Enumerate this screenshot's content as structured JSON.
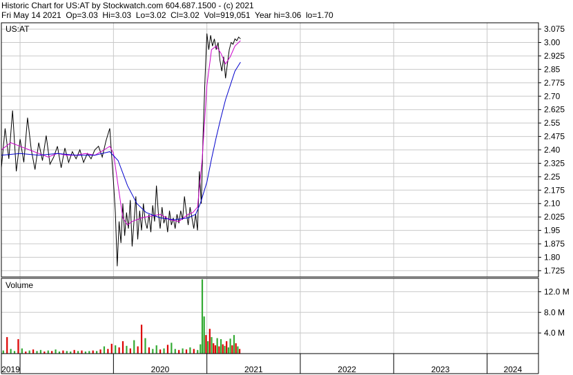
{
  "header": {
    "line1": "Historic Chart for US:AT by Stockwatch.com 604.687.1500 - (c) 2021",
    "line2": "Fri May 14 2021  Op=3.03  Hi=3.03  Lo=3.02  Cl=3.02  Vol=919,051  Year hi=3.06  lo=1.70"
  },
  "colors": {
    "price": "#000000",
    "ma_short": "#cc00cc",
    "ma_long": "#0000cc",
    "volume_up": "#33aa33",
    "volume_down": "#dd0000",
    "grid": "#c8c8c8",
    "frame": "#000000"
  },
  "chart_data": [
    {
      "type": "line",
      "title": "US:AT",
      "y_ticks": [
        "3.075",
        "3.00",
        "2.925",
        "2.85",
        "2.775",
        "2.70",
        "2.625",
        "2.55",
        "2.475",
        "2.40",
        "2.325",
        "2.25",
        "2.175",
        "2.10",
        "2.025",
        "1.95",
        "1.875",
        "1.80",
        "1.725"
      ],
      "ylim": [
        1.69,
        3.11
      ],
      "x_ticks": [
        "2019",
        "2020",
        "2021",
        "2022",
        "2023",
        "2024"
      ],
      "xlim": [
        2018.8,
        2024.55
      ],
      "grid": true,
      "series": [
        {
          "role": "price",
          "x": [
            2018.8,
            2018.84,
            2018.88,
            2018.92,
            2018.96,
            2019.0,
            2019.04,
            2019.08,
            2019.12,
            2019.16,
            2019.2,
            2019.24,
            2019.28,
            2019.32,
            2019.36,
            2019.4,
            2019.44,
            2019.48,
            2019.52,
            2019.56,
            2019.6,
            2019.64,
            2019.68,
            2019.72,
            2019.76,
            2019.8,
            2019.84,
            2019.88,
            2019.92,
            2019.96,
            2020.0,
            2020.02,
            2020.04,
            2020.06,
            2020.08,
            2020.1,
            2020.12,
            2020.14,
            2020.16,
            2020.18,
            2020.2,
            2020.22,
            2020.24,
            2020.26,
            2020.28,
            2020.3,
            2020.32,
            2020.34,
            2020.36,
            2020.38,
            2020.4,
            2020.42,
            2020.44,
            2020.46,
            2020.48,
            2020.5,
            2020.52,
            2020.54,
            2020.56,
            2020.58,
            2020.6,
            2020.62,
            2020.64,
            2020.66,
            2020.68,
            2020.7,
            2020.72,
            2020.74,
            2020.76,
            2020.78,
            2020.8,
            2020.82,
            2020.84,
            2020.86,
            2020.88,
            2020.9,
            2020.92,
            2020.94,
            2020.96,
            2020.98,
            2021.0,
            2021.02,
            2021.04,
            2021.06,
            2021.08,
            2021.1,
            2021.12,
            2021.14,
            2021.16,
            2021.18,
            2021.2,
            2021.22,
            2021.24,
            2021.26,
            2021.28,
            2021.3,
            2021.32,
            2021.34,
            2021.36
          ],
          "values": [
            2.3,
            2.52,
            2.35,
            2.62,
            2.28,
            2.46,
            2.33,
            2.58,
            2.4,
            2.29,
            2.44,
            2.34,
            2.48,
            2.32,
            2.36,
            2.42,
            2.3,
            2.41,
            2.33,
            2.39,
            2.35,
            2.4,
            2.33,
            2.38,
            2.35,
            2.4,
            2.42,
            2.36,
            2.45,
            2.52,
            2.22,
            2.05,
            1.75,
            2.0,
            1.88,
            2.1,
            1.92,
            2.05,
            1.96,
            2.12,
            1.86,
            2.0,
            2.14,
            1.9,
            2.06,
            1.95,
            2.1,
            2.0,
            1.96,
            2.04,
            1.94,
            2.09,
            2.0,
            2.2,
            2.05,
            1.96,
            2.08,
            1.99,
            2.03,
            1.94,
            2.06,
            1.98,
            2.02,
            1.96,
            2.04,
            1.99,
            2.06,
            2.01,
            2.14,
            2.05,
            1.98,
            2.08,
            2.02,
            1.96,
            2.04,
            1.95,
            2.28,
            2.1,
            2.5,
            2.8,
            3.05,
            2.96,
            3.04,
            2.98,
            3.02,
            2.96,
            3.0,
            2.9,
            2.84,
            2.92,
            2.8,
            2.88,
            2.96,
            3.0,
            2.99,
            3.02,
            3.01,
            3.03,
            3.02
          ]
        },
        {
          "role": "moving-average-short",
          "x": [
            2018.8,
            2018.9,
            2019.0,
            2019.1,
            2019.2,
            2019.3,
            2019.4,
            2019.5,
            2019.6,
            2019.7,
            2019.8,
            2019.9,
            2019.96,
            2020.0,
            2020.05,
            2020.1,
            2020.15,
            2020.2,
            2020.3,
            2020.4,
            2020.5,
            2020.6,
            2020.7,
            2020.8,
            2020.85,
            2020.9,
            2020.95,
            2021.0,
            2021.05,
            2021.1,
            2021.15,
            2021.2,
            2021.25,
            2021.3,
            2021.36
          ],
          "values": [
            2.4,
            2.44,
            2.42,
            2.4,
            2.38,
            2.36,
            2.38,
            2.37,
            2.37,
            2.38,
            2.37,
            2.4,
            2.42,
            2.38,
            2.2,
            2.02,
            1.98,
            2.0,
            2.02,
            2.03,
            2.04,
            2.01,
            2.0,
            2.04,
            2.05,
            2.08,
            2.35,
            2.76,
            2.96,
            2.98,
            2.94,
            2.88,
            2.92,
            2.98,
            3.01
          ]
        },
        {
          "role": "moving-average-long",
          "x": [
            2018.8,
            2019.0,
            2019.2,
            2019.4,
            2019.6,
            2019.8,
            2019.96,
            2020.05,
            2020.15,
            2020.25,
            2020.35,
            2020.5,
            2020.65,
            2020.8,
            2020.88,
            2020.93,
            2021.0,
            2021.05,
            2021.1,
            2021.15,
            2021.2,
            2021.25,
            2021.3,
            2021.36
          ],
          "values": [
            2.37,
            2.38,
            2.37,
            2.38,
            2.37,
            2.37,
            2.39,
            2.34,
            2.2,
            2.1,
            2.05,
            2.02,
            2.01,
            2.02,
            2.04,
            2.1,
            2.22,
            2.35,
            2.47,
            2.58,
            2.68,
            2.76,
            2.84,
            2.89
          ]
        }
      ]
    },
    {
      "type": "bar",
      "title": "Volume",
      "y_ticks": [
        "12.0 M",
        "8.0 M",
        "4.0 M"
      ],
      "ylim": [
        0,
        14.6
      ],
      "unit": "M",
      "x": [
        2018.82,
        2018.86,
        2018.9,
        2018.94,
        2018.98,
        2019.02,
        2019.06,
        2019.1,
        2019.14,
        2019.18,
        2019.22,
        2019.26,
        2019.3,
        2019.34,
        2019.38,
        2019.42,
        2019.46,
        2019.5,
        2019.54,
        2019.58,
        2019.62,
        2019.66,
        2019.7,
        2019.74,
        2019.78,
        2019.82,
        2019.86,
        2019.9,
        2019.94,
        2019.98,
        2020.02,
        2020.06,
        2020.1,
        2020.14,
        2020.18,
        2020.22,
        2020.26,
        2020.3,
        2020.34,
        2020.38,
        2020.42,
        2020.46,
        2020.5,
        2020.54,
        2020.58,
        2020.62,
        2020.66,
        2020.7,
        2020.74,
        2020.78,
        2020.82,
        2020.86,
        2020.9,
        2020.93,
        2020.95,
        2020.97,
        2020.99,
        2021.01,
        2021.03,
        2021.05,
        2021.07,
        2021.09,
        2021.11,
        2021.13,
        2021.15,
        2021.17,
        2021.19,
        2021.21,
        2021.23,
        2021.25,
        2021.27,
        2021.29,
        2021.31,
        2021.33,
        2021.35
      ],
      "values": [
        0.6,
        3.2,
        0.9,
        0.5,
        2.8,
        1.0,
        0.4,
        0.6,
        0.8,
        0.5,
        0.7,
        0.4,
        0.6,
        0.5,
        0.8,
        0.4,
        0.6,
        0.5,
        0.4,
        0.7,
        0.5,
        0.6,
        0.4,
        0.5,
        0.6,
        0.5,
        0.8,
        1.4,
        0.9,
        1.9,
        1.6,
        1.2,
        2.4,
        1.5,
        1.0,
        2.6,
        1.4,
        5.6,
        3.0,
        1.2,
        0.9,
        1.6,
        0.8,
        1.0,
        1.7,
        2.1,
        0.9,
        0.7,
        1.0,
        0.8,
        1.2,
        0.9,
        0.7,
        1.8,
        14.4,
        7.2,
        3.6,
        2.4,
        4.8,
        3.2,
        2.0,
        1.6,
        3.0,
        1.4,
        2.8,
        1.8,
        1.5,
        2.4,
        1.2,
        2.9,
        1.6,
        3.6,
        2.0,
        1.4,
        0.9
      ],
      "directions": [
        "up",
        "down",
        "up",
        "up",
        "down",
        "up",
        "down",
        "up",
        "down",
        "up",
        "up",
        "down",
        "up",
        "down",
        "up",
        "up",
        "down",
        "up",
        "up",
        "down",
        "up",
        "down",
        "up",
        "up",
        "down",
        "up",
        "down",
        "up",
        "down",
        "down",
        "up",
        "down",
        "down",
        "up",
        "down",
        "up",
        "down",
        "down",
        "up",
        "down",
        "up",
        "up",
        "down",
        "up",
        "down",
        "up",
        "up",
        "down",
        "up",
        "down",
        "up",
        "down",
        "up",
        "up",
        "up",
        "up",
        "down",
        "up",
        "down",
        "up",
        "down",
        "down",
        "up",
        "down",
        "up",
        "down",
        "up",
        "down",
        "up",
        "up",
        "down",
        "up",
        "down",
        "up",
        "down"
      ]
    }
  ]
}
